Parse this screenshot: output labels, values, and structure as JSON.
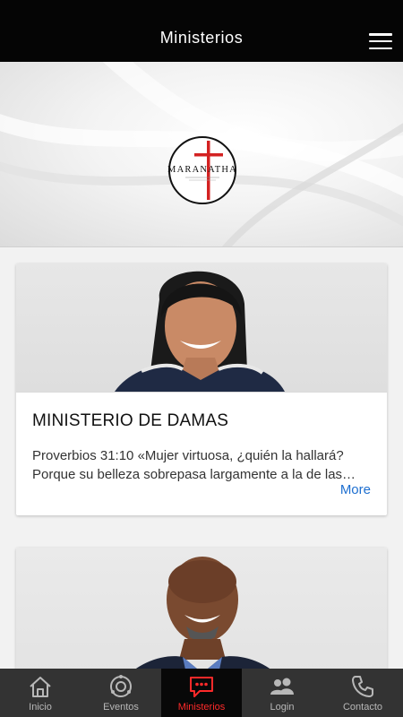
{
  "header": {
    "title": "Ministerios",
    "menu_icon": "hamburger-menu-icon"
  },
  "hero": {
    "logo_text": "MARANATHA",
    "accent_color": "#d32222"
  },
  "cards": [
    {
      "title": "MINISTERIO DE DAMAS",
      "description": "Proverbios 31:10 «Mujer virtuosa, ¿quién la hallará? Porque su belleza sobrepasa largamente a la de las…",
      "more_label": "More"
    },
    {
      "title": "",
      "description": "",
      "more_label": ""
    }
  ],
  "tabbar": {
    "active_color": "#ff2a2a",
    "items": [
      {
        "label": "Inicio",
        "icon": "home-icon"
      },
      {
        "label": "Eventos",
        "icon": "events-icon"
      },
      {
        "label": "Ministerios",
        "icon": "chat-bubble-icon",
        "active": true
      },
      {
        "label": "Login",
        "icon": "users-icon"
      },
      {
        "label": "Contacto",
        "icon": "phone-icon"
      }
    ]
  }
}
